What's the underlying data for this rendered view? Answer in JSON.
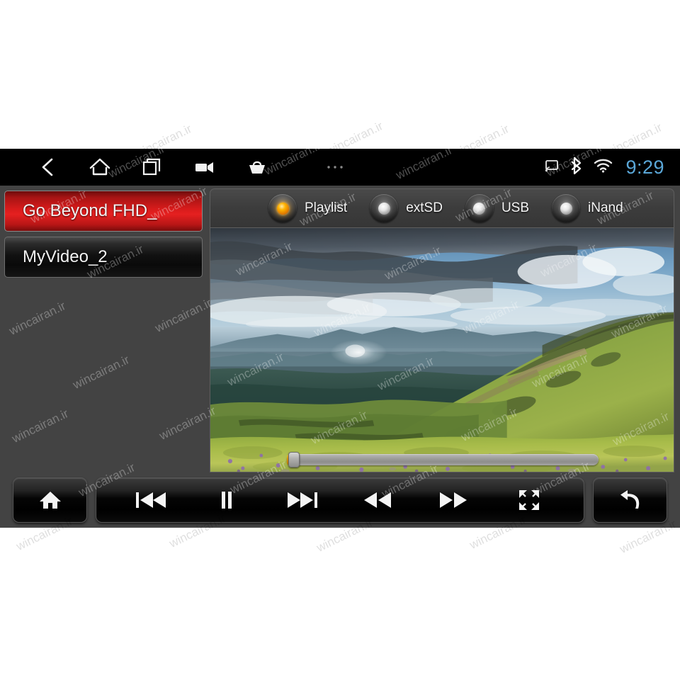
{
  "statusbar": {
    "nav": [
      {
        "name": "back-icon",
        "label": "Back"
      },
      {
        "name": "home-icon",
        "label": "Home"
      },
      {
        "name": "recents-icon",
        "label": "Recent apps"
      },
      {
        "name": "camera-icon",
        "label": "Camera"
      },
      {
        "name": "basket-icon",
        "label": "Apps"
      },
      {
        "name": "more-icon",
        "label": "More"
      }
    ],
    "indicators": [
      {
        "name": "cast-icon",
        "label": "Cast"
      },
      {
        "name": "bluetooth-icon",
        "label": "Bluetooth"
      },
      {
        "name": "wifi-icon",
        "label": "Wi-Fi"
      }
    ],
    "clock": "9:29",
    "clock_color": "#5aa7d8"
  },
  "sidebar": {
    "items": [
      {
        "label": "Go Beyond FHD_",
        "selected": true
      },
      {
        "label": "MyVideo_2",
        "selected": false
      }
    ]
  },
  "sources": {
    "items": [
      {
        "label": "Playlist",
        "active": true
      },
      {
        "label": "extSD",
        "active": false
      },
      {
        "label": "USB",
        "active": false
      },
      {
        "label": "iNand",
        "active": false
      }
    ],
    "active_color": "#ffb300"
  },
  "player": {
    "progress_percent": 1,
    "artwork_description": "HDR mountain landscape with storm clouds, hazy valley and green alpine meadow with purple wildflowers"
  },
  "controls": {
    "home": {
      "icon": "home-icon",
      "label": "Home"
    },
    "media": [
      {
        "icon": "previous-track-icon",
        "label": "Previous"
      },
      {
        "icon": "pause-icon",
        "label": "Pause"
      },
      {
        "icon": "next-track-icon",
        "label": "Next"
      },
      {
        "icon": "rewind-icon",
        "label": "Rewind"
      },
      {
        "icon": "fast-forward-icon",
        "label": "Fast forward"
      },
      {
        "icon": "fullscreen-icon",
        "label": "Fullscreen"
      }
    ],
    "back": {
      "icon": "return-arrow-icon",
      "label": "Return"
    }
  },
  "watermark": {
    "text": "wincairan.ir"
  }
}
